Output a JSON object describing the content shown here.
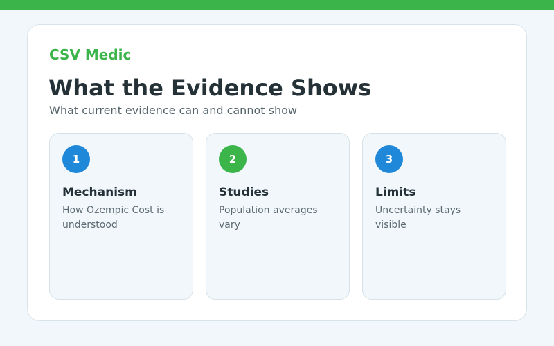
{
  "colors": {
    "brand_green": "#3bb54a",
    "accent_blue": "#1f88d9",
    "title_text": "#243238",
    "muted_text": "#55646b",
    "card_tint": "#f1f7fa",
    "page_background": "#f2f7fb"
  },
  "header": {
    "brand": "CSV Medic",
    "title": "What the Evidence Shows",
    "subtitle": "What current evidence can and cannot show"
  },
  "steps": [
    {
      "number": "1",
      "title": "Mechanism",
      "description": "How Ozempic Cost is understood",
      "badge_color": "#1f88d9"
    },
    {
      "number": "2",
      "title": "Studies",
      "description": "Population averages vary",
      "badge_color": "#3bb54a"
    },
    {
      "number": "3",
      "title": "Limits",
      "description": "Uncertainty stays visible",
      "badge_color": "#1f88d9"
    }
  ]
}
